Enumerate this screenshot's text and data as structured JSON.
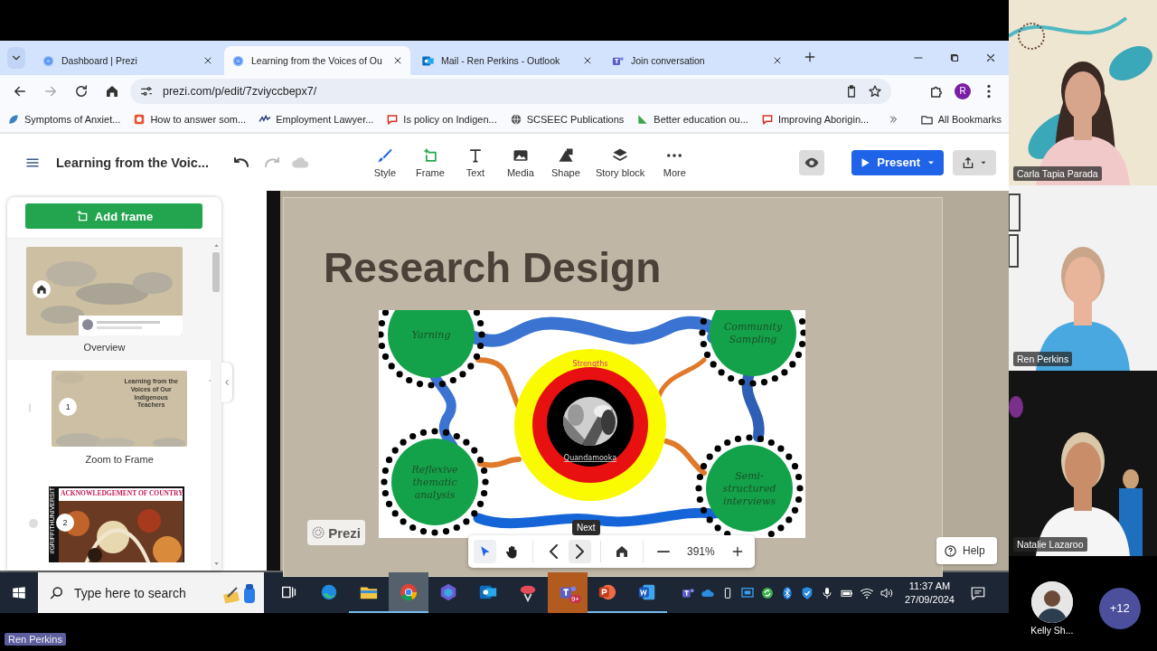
{
  "browser": {
    "tabs": [
      {
        "title": "Dashboard | Prezi",
        "selected": false
      },
      {
        "title": "Learning from the Voices of Ou",
        "selected": true
      },
      {
        "title": "Mail - Ren Perkins - Outlook",
        "selected": false
      },
      {
        "title": "Join conversation",
        "selected": false
      }
    ],
    "url": "prezi.com/p/edit/7zviyccbepx7/",
    "profile": "R",
    "bookmarks": [
      {
        "title": "Symptoms of Anxiet..."
      },
      {
        "title": "How to answer som..."
      },
      {
        "title": "Employment Lawyer..."
      },
      {
        "title": "Is policy on Indigen..."
      },
      {
        "title": "SCSEEC Publications"
      },
      {
        "title": "Better education ou..."
      },
      {
        "title": "Improving Aborigin..."
      }
    ],
    "all_bookmarks": "All Bookmarks"
  },
  "editor": {
    "title": "Learning from the Voic...",
    "tools": [
      {
        "label": "Style",
        "kind": "style"
      },
      {
        "label": "Frame",
        "kind": "frame"
      },
      {
        "label": "Text",
        "kind": "text"
      },
      {
        "label": "Media",
        "kind": "media"
      },
      {
        "label": "Shape",
        "kind": "shape"
      },
      {
        "label": "Story block",
        "kind": "story"
      },
      {
        "label": "More",
        "kind": "more"
      }
    ],
    "present": "Present"
  },
  "frames_panel": {
    "add_frame": "Add frame",
    "frames": [
      {
        "kind": "overview",
        "label": "Overview"
      },
      {
        "kind": "title",
        "number": "1",
        "heading": "Learning from the Voices of Our Indigenous Teachers",
        "label": "Zoom to Frame"
      },
      {
        "kind": "artwork",
        "number": "2",
        "heading": "ACKNOWLEDGEMENT OF COUNTRY",
        "side_text": "#GRIFFITHUNIVERSIT"
      }
    ]
  },
  "slide": {
    "title": "Research Design",
    "diagram": {
      "top_label": "Strengths",
      "center_label": "Quandamooka",
      "nodes": [
        {
          "lines": [
            "Yarning"
          ]
        },
        {
          "lines": [
            "Community",
            "Sampling"
          ]
        },
        {
          "lines": [
            "Reflexive",
            "thematic",
            "analysis"
          ]
        },
        {
          "lines": [
            "Semi-",
            "structured",
            "interviews"
          ]
        }
      ]
    }
  },
  "prezi_badge": "Prezi",
  "nav": {
    "tools": [
      {
        "kind": "select",
        "selected": true
      },
      {
        "kind": "hand",
        "selected": false
      }
    ],
    "tooltip": "Next",
    "zoom": "391%"
  },
  "help": "Help",
  "taskbar": {
    "search_placeholder": "Type here to search",
    "apps": [
      {
        "kind": "taskview",
        "open": false,
        "selected": false
      },
      {
        "kind": "edge",
        "open": false,
        "selected": false
      },
      {
        "kind": "folder",
        "open": true,
        "selected": false
      },
      {
        "kind": "chrome",
        "open": true,
        "selected": true
      },
      {
        "kind": "copilot",
        "open": false,
        "selected": false
      },
      {
        "kind": "outlook",
        "open": false,
        "selected": false
      },
      {
        "kind": "snip",
        "open": false,
        "selected": false
      },
      {
        "kind": "teams",
        "open": false,
        "selected": false,
        "badge": "9+"
      },
      {
        "kind": "powerpoint",
        "open": true,
        "selected": false
      },
      {
        "kind": "word",
        "open": true,
        "selected": false
      }
    ],
    "time": "11:37 AM",
    "date": "27/09/2024"
  },
  "meeting": {
    "participants": [
      {
        "name": "Carla Tapia Parada"
      },
      {
        "name": "Ren Perkins"
      },
      {
        "name": "Natalie Lazaroo"
      }
    ],
    "avatar_name": "Kelly Sh...",
    "more": "+12",
    "speaker": "Ren Perkins"
  }
}
